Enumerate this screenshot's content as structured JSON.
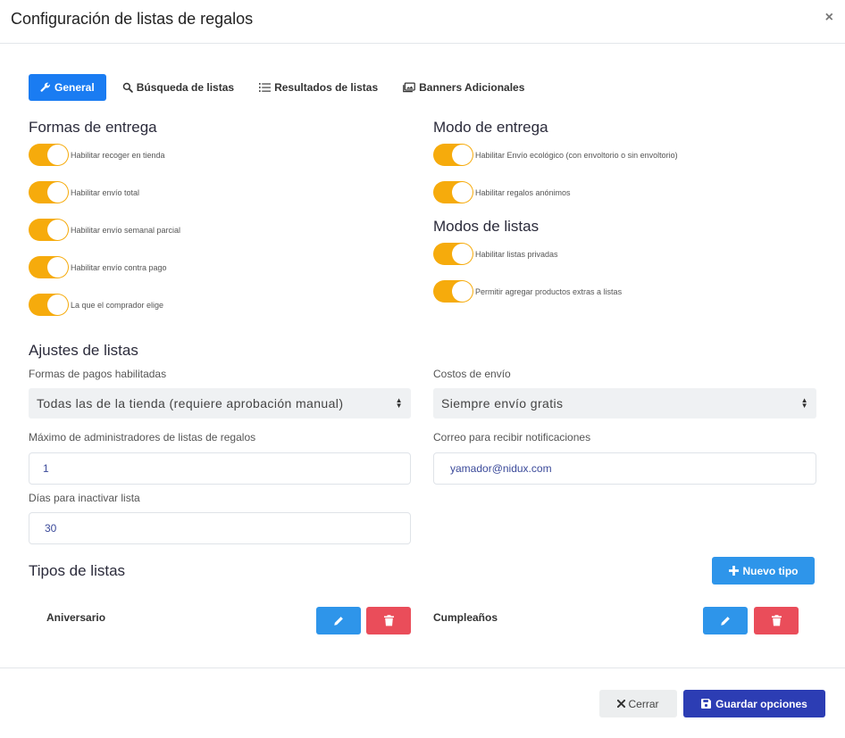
{
  "modal": {
    "title": "Configuración de listas de regalos",
    "close_glyph": "×"
  },
  "tabs": [
    {
      "label": "General",
      "icon": "wrench-icon",
      "active": true
    },
    {
      "label": "Búsqueda de listas",
      "icon": "search-icon",
      "active": false
    },
    {
      "label": "Resultados de listas",
      "icon": "list-icon",
      "active": false
    },
    {
      "label": "Banners Adicionales",
      "icon": "images-icon",
      "active": false
    }
  ],
  "delivery_forms": {
    "title": "Formas de entrega",
    "options": [
      {
        "label": "Habilitar recoger en tienda",
        "enabled": true
      },
      {
        "label": "Habilitar envío total",
        "enabled": true
      },
      {
        "label": "Habilitar envío semanal parcial",
        "enabled": true
      },
      {
        "label": "Habilitar envío contra pago",
        "enabled": true
      },
      {
        "label": "La que el comprador elige",
        "enabled": true
      }
    ]
  },
  "delivery_mode": {
    "title": "Modo de entrega",
    "options": [
      {
        "label": "Habilitar Envío ecológico (con envoltorio o sin envoltorio)",
        "enabled": true
      },
      {
        "label": "Habilitar regalos anónimos",
        "enabled": true
      }
    ]
  },
  "list_modes": {
    "title": "Modos de listas",
    "options": [
      {
        "label": "Habilitar listas privadas",
        "enabled": true
      },
      {
        "label": "Permitir agregar productos extras a listas",
        "enabled": true
      }
    ]
  },
  "settings": {
    "title": "Ajustes de listas",
    "payment_label": "Formas de pagos habilitadas",
    "payment_value": "Todas las de la tienda (requiere aprobación manual)",
    "shipping_label": "Costos de envío",
    "shipping_value": "Siempre envío gratis",
    "max_admins_label": "Máximo de administradores de listas de regalos",
    "max_admins_value": "1",
    "email_label": "Correo para recibir notificaciones",
    "email_value": "yamador@nidux.com",
    "inactive_days_label": "Días para inactivar lista",
    "inactive_days_value": "30"
  },
  "list_types": {
    "title": "Tipos de listas",
    "new_button": "Nuevo tipo",
    "items": [
      {
        "name": "Aniversario"
      },
      {
        "name": "Cumpleaños"
      }
    ]
  },
  "footer": {
    "cancel": "Cerrar",
    "save": "Guardar opciones"
  },
  "colors": {
    "primary": "#1a7cf2",
    "toggle_on": "#f6ab0c",
    "edit": "#2e95ea",
    "delete": "#ea4d5a",
    "save": "#2c3db4"
  }
}
